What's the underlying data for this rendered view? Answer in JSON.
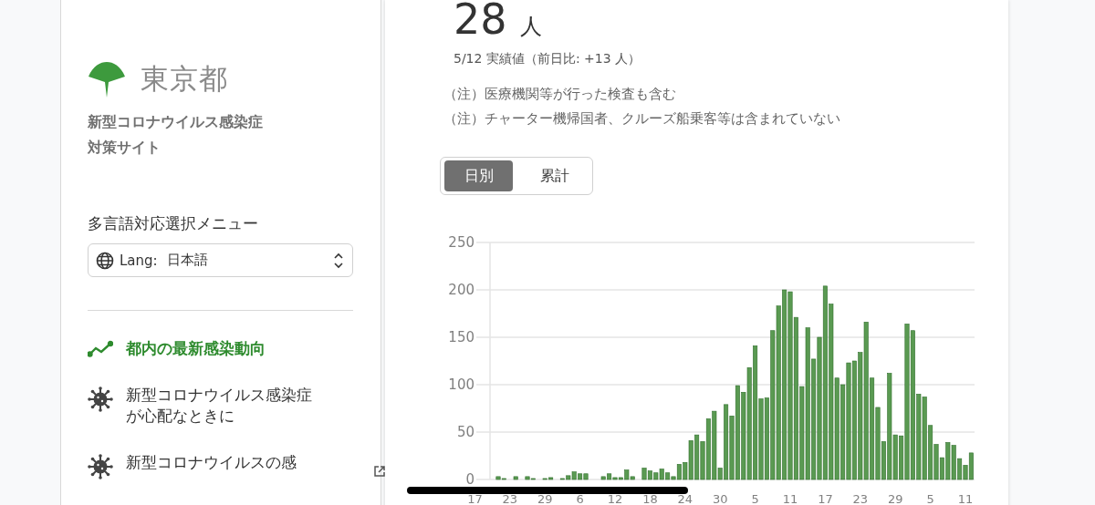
{
  "sidebar": {
    "logo_text": "東京都",
    "site_title_lines": [
      "新型コロナウイルス感染症",
      "対策サイト"
    ],
    "language_menu_label": "多言語対応選択メニュー",
    "language_select": {
      "prefix": "Lang:",
      "value": "日本語"
    },
    "nav_items": [
      {
        "kind": "trend",
        "label_lines": [
          "都内の最新感染動向"
        ],
        "selected": true,
        "external": false
      },
      {
        "kind": "virus",
        "label_lines": [
          "新型コロナウイルス感染症",
          "が心配なときに"
        ],
        "selected": false,
        "external": false
      },
      {
        "kind": "virus",
        "label_lines": [
          "新型コロナウイルスの感"
        ],
        "selected": false,
        "external": true
      }
    ]
  },
  "card": {
    "count": "28",
    "unit": "人",
    "date_note": "5/12 実績値（前日比: +13 人）",
    "notes": [
      "（注）医療機関等が行った検査も含む",
      "（注）チャーター機帰国者、クルーズ船乗客等は含まれていない"
    ],
    "toggle": [
      {
        "label": "日別",
        "selected": true
      },
      {
        "label": "累計",
        "selected": false
      }
    ],
    "chart_data": {
      "type": "bar",
      "grid": true,
      "categories": [
        "17",
        null,
        null,
        null,
        null,
        null,
        "23",
        null,
        null,
        null,
        null,
        null,
        "29",
        null,
        null,
        null,
        null,
        null,
        "6",
        null,
        null,
        null,
        null,
        null,
        "12",
        null,
        null,
        null,
        null,
        null,
        "18",
        null,
        null,
        null,
        null,
        null,
        "24",
        null,
        null,
        null,
        null,
        null,
        "30",
        null,
        null,
        null,
        null,
        null,
        "5",
        null,
        null,
        null,
        null,
        null,
        "11",
        null,
        null,
        null,
        null,
        null,
        "17",
        null,
        null,
        null,
        null,
        null,
        "23",
        null,
        null,
        null,
        null,
        null,
        "29",
        null,
        null,
        null,
        null,
        null,
        "5",
        null,
        null,
        null,
        null,
        null,
        "11",
        null
      ],
      "series": [
        {
          "color": "#5a9a52",
          "values": [
            0,
            0,
            0,
            0,
            3,
            1,
            0,
            3,
            0,
            3,
            1,
            0,
            1,
            2,
            0,
            1,
            4,
            8,
            6,
            6,
            0,
            0,
            3,
            6,
            2,
            2,
            10,
            3,
            0,
            12,
            9,
            7,
            11,
            7,
            3,
            16,
            18,
            41,
            47,
            40,
            64,
            72,
            12,
            79,
            67,
            99,
            92,
            118,
            141,
            85,
            86,
            157,
            183,
            200,
            198,
            171,
            98,
            160,
            127,
            150,
            204,
            185,
            107,
            100,
            123,
            125,
            134,
            166,
            107,
            76,
            40,
            112,
            47,
            46,
            164,
            157,
            90,
            87,
            57,
            37,
            23,
            39,
            36,
            22,
            15,
            28
          ]
        }
      ],
      "ylim": [
        0,
        250
      ],
      "yticks": [
        0,
        50,
        100,
        150,
        200,
        250
      ]
    }
  }
}
